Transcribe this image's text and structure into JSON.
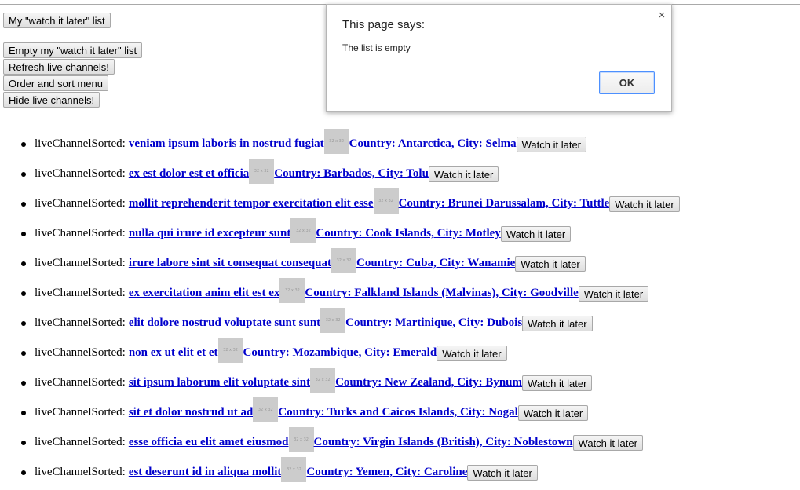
{
  "toolbar": {
    "watch_later_list": "My \"watch it later\" list",
    "empty_list": "Empty my \"watch it later\" list",
    "refresh": "Refresh live channels!",
    "order_sort": "Order and sort menu",
    "hide": "Hide live channels!"
  },
  "dialog": {
    "title": "This page says:",
    "message": "The list is empty",
    "ok_label": "OK",
    "close_glyph": "×"
  },
  "thumb_placeholder": "32 x 32",
  "channels": [
    {
      "prefix": "liveChannelSorted:",
      "title": "veniam ipsum laboris in nostrud fugiat",
      "location": "Country: Antarctica, City: Selma",
      "button": "Watch it later"
    },
    {
      "prefix": "liveChannelSorted:",
      "title": "ex est dolor est et officia",
      "location": "Country: Barbados, City: Tolu",
      "button": "Watch it later"
    },
    {
      "prefix": "liveChannelSorted:",
      "title": "mollit reprehenderit tempor exercitation elit esse",
      "location": "Country: Brunei Darussalam, City: Tuttle",
      "button": "Watch it later"
    },
    {
      "prefix": "liveChannelSorted:",
      "title": "nulla qui irure id excepteur sunt",
      "location": "Country: Cook Islands, City: Motley",
      "button": "Watch it later"
    },
    {
      "prefix": "liveChannelSorted:",
      "title": "irure labore sint sit consequat consequat",
      "location": "Country: Cuba, City: Wanamie",
      "button": "Watch it later"
    },
    {
      "prefix": "liveChannelSorted:",
      "title": "ex exercitation anim elit est ex",
      "location": "Country: Falkland Islands (Malvinas), City: Goodville",
      "button": "Watch it later"
    },
    {
      "prefix": "liveChannelSorted:",
      "title": "elit dolore nostrud voluptate sunt sunt",
      "location": "Country: Martinique, City: Dubois",
      "button": "Watch it later"
    },
    {
      "prefix": "liveChannelSorted:",
      "title": "non ex ut elit et et",
      "location": "Country: Mozambique, City: Emerald",
      "button": "Watch it later"
    },
    {
      "prefix": "liveChannelSorted:",
      "title": "sit ipsum laborum elit voluptate sint",
      "location": "Country: New Zealand, City: Bynum",
      "button": "Watch it later"
    },
    {
      "prefix": "liveChannelSorted:",
      "title": "sit et dolor nostrud ut ad",
      "location": "Country: Turks and Caicos Islands, City: Nogal",
      "button": "Watch it later"
    },
    {
      "prefix": "liveChannelSorted:",
      "title": "esse officia eu elit amet eiusmod",
      "location": "Country: Virgin Islands (British), City: Noblestown",
      "button": "Watch it later"
    },
    {
      "prefix": "liveChannelSorted:",
      "title": "est deserunt id in aliqua mollit",
      "location": "Country: Yemen, City: Caroline",
      "button": "Watch it later"
    }
  ]
}
